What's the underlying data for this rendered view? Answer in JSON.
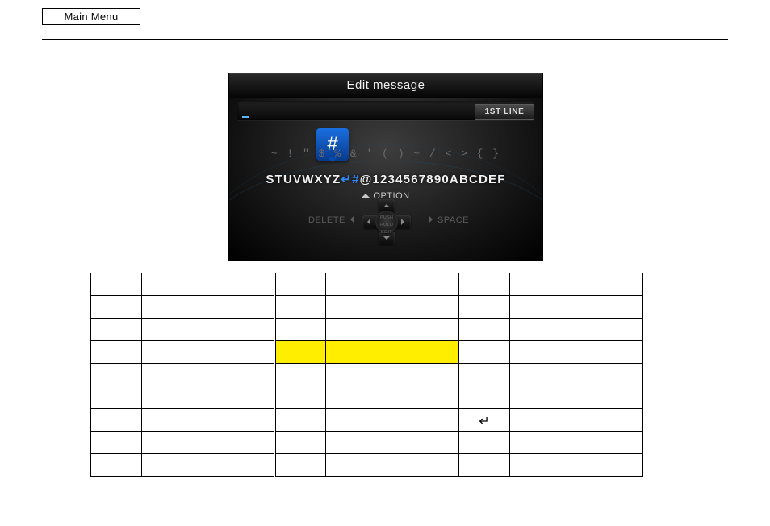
{
  "header": {
    "main_menu_label": "Main Menu"
  },
  "screen": {
    "title": "Edit message",
    "first_line_badge": "1ST LINE",
    "bubble_char": "#",
    "symbol_row": "~ ! \"   $ % & ' ( ) ~ / < > { }",
    "char_row_left": "STUVWXYZ",
    "char_row_sel_prefix": "↵",
    "char_row_sel": "#",
    "char_row_right": "@1234567890ABCDEF",
    "option_label": "OPTION",
    "delete_label": "DELETE",
    "space_label": "SPACE",
    "center_l1": "PUSH HOLD",
    "center_l2": "EDIT"
  },
  "table": {
    "rows": [
      {
        "c1": "",
        "c2": "",
        "c3": "",
        "c4": "",
        "c5": "",
        "c6": "",
        "hl": false
      },
      {
        "c1": "",
        "c2": "",
        "c3": "",
        "c4": "",
        "c5": "",
        "c6": "",
        "hl": false
      },
      {
        "c1": "",
        "c2": "",
        "c3": "",
        "c4": "",
        "c5": "",
        "c6": "",
        "hl": false
      },
      {
        "c1": "",
        "c2": "",
        "c3": "",
        "c4": "",
        "c5": "",
        "c6": "",
        "hl": true
      },
      {
        "c1": "",
        "c2": "",
        "c3": "",
        "c4": "",
        "c5": "",
        "c6": "",
        "hl": false
      },
      {
        "c1": "",
        "c2": "",
        "c3": "",
        "c4": "",
        "c5": "",
        "c6": "",
        "hl": false
      },
      {
        "c1": "",
        "c2": "",
        "c3": "",
        "c4": "",
        "c5": "↵",
        "c6": "",
        "hl": false
      },
      {
        "c1": "",
        "c2": "",
        "c3": "",
        "c4": "",
        "c5": "",
        "c6": "",
        "hl": false
      },
      {
        "c1": "",
        "c2": "",
        "c3": "",
        "c4": "",
        "c5": "",
        "c6": "",
        "hl": false
      }
    ]
  }
}
